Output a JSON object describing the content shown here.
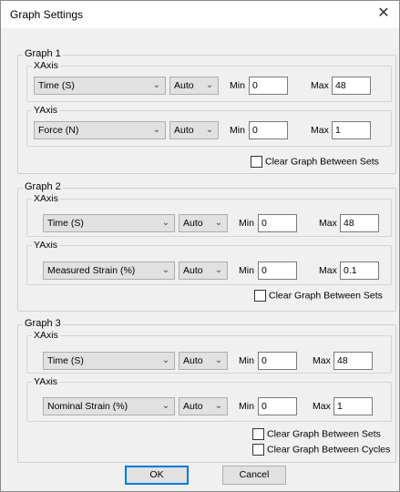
{
  "window": {
    "title": "Graph Settings",
    "close_glyph": "✕",
    "close_icon": "close-icon"
  },
  "graphs": [
    {
      "label": "Graph 1",
      "xaxis": {
        "label": "XAxis",
        "quantity": "Time (S)",
        "scale": "Auto",
        "min_label": "Min",
        "min": "0",
        "max_label": "Max",
        "max": "48"
      },
      "yaxis": {
        "label": "YAxis",
        "quantity": "Force (N)",
        "scale": "Auto",
        "min_label": "Min",
        "min": "0",
        "max_label": "Max",
        "max": "1"
      },
      "checkboxes": [
        {
          "label": "Clear Graph Between Sets",
          "checked": false
        }
      ]
    },
    {
      "label": "Graph 2",
      "xaxis": {
        "label": "XAxis",
        "quantity": "Time (S)",
        "scale": "Auto",
        "min_label": "Min",
        "min": "0",
        "max_label": "Max",
        "max": "48"
      },
      "yaxis": {
        "label": "YAxis",
        "quantity": "Measured Strain (%)",
        "scale": "Auto",
        "min_label": "Min",
        "min": "0",
        "max_label": "Max",
        "max": "0.1"
      },
      "checkboxes": [
        {
          "label": "Clear Graph Between Sets",
          "checked": false
        }
      ]
    },
    {
      "label": "Graph 3",
      "xaxis": {
        "label": "XAxis",
        "quantity": "Time (S)",
        "scale": "Auto",
        "min_label": "Min",
        "min": "0",
        "max_label": "Max",
        "max": "48"
      },
      "yaxis": {
        "label": "YAxis",
        "quantity": "Nominal Strain (%)",
        "scale": "Auto",
        "min_label": "Min",
        "min": "0",
        "max_label": "Max",
        "max": "1"
      },
      "checkboxes": [
        {
          "label": "Clear Graph Between Sets",
          "checked": false
        },
        {
          "label": "Clear Graph Between Cycles",
          "checked": false
        }
      ]
    }
  ],
  "buttons": {
    "ok": "OK",
    "cancel": "Cancel"
  },
  "icons": {
    "dropdown": "chevron-down-icon",
    "chevron_glyph": "⌄"
  },
  "colors": {
    "dialog_bg": "#f0f0f0",
    "button_bg": "#e1e1e1",
    "focus_border": "#0078d7"
  }
}
